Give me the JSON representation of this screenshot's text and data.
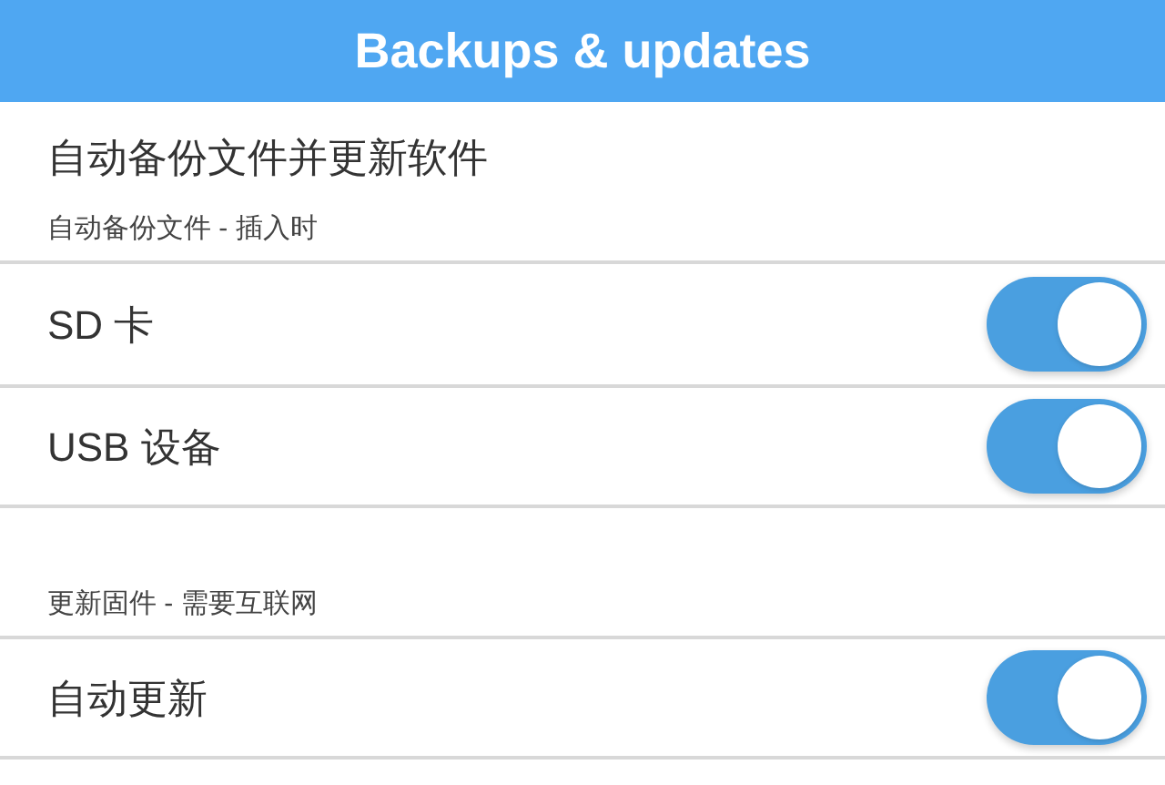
{
  "header": {
    "title": "Backups & updates"
  },
  "sections": [
    {
      "title": "自动备份文件并更新软件",
      "subtitle": "自动备份文件 - 插入时",
      "rows": [
        {
          "label": "SD 卡",
          "on": true
        },
        {
          "label": "USB 设备",
          "on": true
        }
      ]
    },
    {
      "subtitle": "更新固件 - 需要互联网",
      "rows": [
        {
          "label": "自动更新",
          "on": true
        }
      ]
    }
  ]
}
